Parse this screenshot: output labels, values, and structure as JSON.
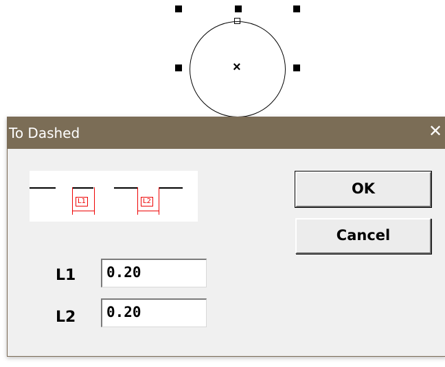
{
  "dialog": {
    "title": "To Dashed",
    "close_glyph": "✕",
    "preview": {
      "labels": [
        "L1",
        "L2"
      ]
    },
    "buttons": {
      "ok": "OK",
      "cancel": "Cancel"
    },
    "fields": [
      {
        "label": "L1",
        "value": "0.20"
      },
      {
        "label": "L2",
        "value": "0.20"
      }
    ]
  },
  "canvas": {
    "center_marker": "×"
  }
}
